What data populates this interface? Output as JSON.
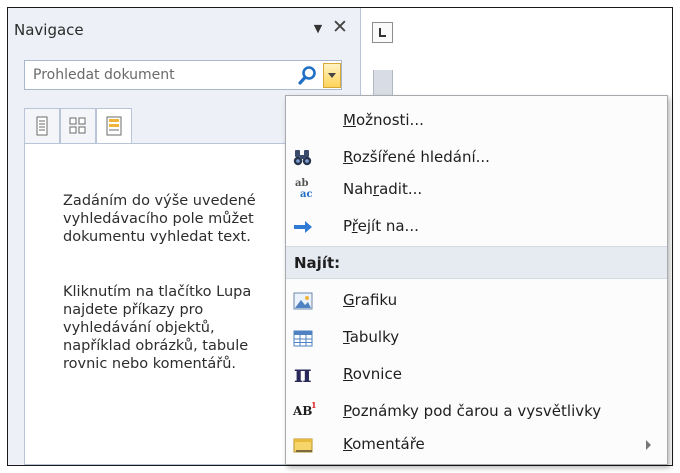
{
  "nav": {
    "title": "Navigace",
    "dropdown_icon": "▼",
    "close_icon": "✕",
    "search_placeholder": "Prohledat dokument",
    "help_paragraph1": [
      "Zadáním do výše uvedené",
      "vyhledávacího pole můžet",
      "dokumentu vyhledat text."
    ],
    "help_paragraph2": [
      "Kliknutím na tlačítko Lupa",
      "najdete příkazy pro",
      "vyhledávání objektů,",
      "například obrázků, tabule",
      "rovnic nebo komentářů."
    ]
  },
  "menu": {
    "section_header": "Najít:",
    "items": [
      {
        "pre": "",
        "key": "M",
        "post": "ožnosti...",
        "icon": "none"
      },
      {
        "pre": "",
        "key": "R",
        "post": "ozšířené hledání...",
        "icon": "binoculars-icon"
      },
      {
        "pre": "Nah",
        "key": "r",
        "post": "adit...",
        "icon": "replace-icon"
      },
      {
        "pre": "P",
        "key": "ř",
        "post": "ejít na...",
        "icon": "arrow-right-icon"
      },
      {
        "pre": "",
        "key": "G",
        "post": "rafiku",
        "icon": "picture-icon"
      },
      {
        "pre": "",
        "key": "T",
        "post": "abulky",
        "icon": "table-icon"
      },
      {
        "pre": "",
        "key": "R",
        "post": "ovnice",
        "icon": "pi-icon"
      },
      {
        "pre": "",
        "key": "P",
        "post": "oznámky pod čarou a vysvětlivky",
        "icon": "footnote-icon"
      },
      {
        "pre": "",
        "key": "K",
        "post": "omentáře",
        "icon": "comment-icon"
      }
    ],
    "icon_glyphs": {
      "replace_top": "ab",
      "replace_bottom": "ac",
      "pi": "π",
      "footnote": "AB",
      "footnote_sup": "1"
    }
  },
  "colors": {
    "accent_blue": "#1f6fc5",
    "menu_highlight": "#e6ebf1",
    "lupa_yellow": "#ffd45a"
  }
}
